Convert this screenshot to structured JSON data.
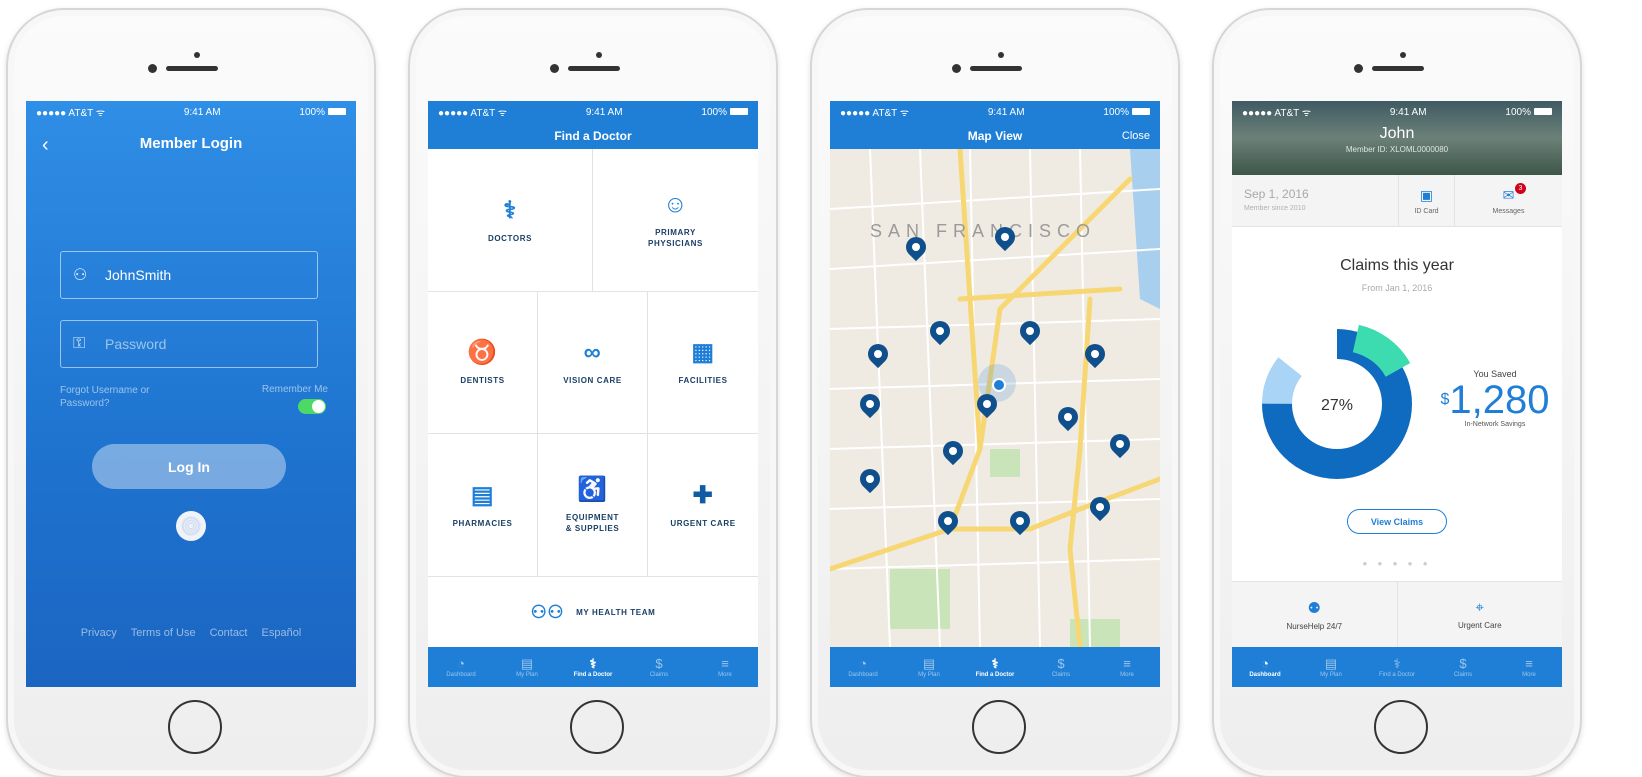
{
  "status": {
    "carrier": "●●●●● AT&T ᯤ",
    "time": "9:41 AM",
    "battery": "100%"
  },
  "login": {
    "title": "Member Login",
    "back": "‹",
    "username": "JohnSmith",
    "password_placeholder": "Password",
    "forgot": "Forgot Username or Password?",
    "remember": "Remember Me",
    "remember_on": true,
    "login_button": "Log In",
    "links": [
      "Privacy",
      "Terms of Use",
      "Contact",
      "Español"
    ]
  },
  "find_doctor": {
    "title": "Find a Doctor",
    "categories": [
      {
        "label1": "DOCTORS",
        "label2": "",
        "icon": "stethoscope-icon"
      },
      {
        "label1": "PRIMARY",
        "label2": "PHYSICIANS",
        "icon": "physician-icon"
      },
      {
        "label1": "DENTISTS",
        "label2": "",
        "icon": "tooth-icon"
      },
      {
        "label1": "VISION CARE",
        "label2": "",
        "icon": "glasses-icon"
      },
      {
        "label1": "FACILITIES",
        "label2": "",
        "icon": "building-icon"
      },
      {
        "label1": "PHARMACIES",
        "label2": "",
        "icon": "pill-bottle-icon"
      },
      {
        "label1": "EQUIPMENT",
        "label2": "& SUPPLIES",
        "icon": "wheelchair-icon"
      },
      {
        "label1": "URGENT CARE",
        "label2": "",
        "icon": "urgent-care-pin-icon"
      }
    ],
    "health_team": "MY HEALTH TEAM"
  },
  "map_view": {
    "title": "Map View",
    "close": "Close",
    "city_label": "SAN FRANCISCO"
  },
  "dashboard": {
    "name": "John",
    "member_id": "Member ID: XLOML0000080",
    "date": "Sep 1, 2016",
    "member_since": "Member since 2010",
    "id_card": "ID Card",
    "messages": "Messages",
    "messages_count": "3",
    "claims_title": "Claims this year",
    "claims_sub": "From Jan 1, 2016",
    "percent": "27%",
    "you_saved": "You Saved",
    "currency": "$",
    "amount": "1,280",
    "network_savings": "In-Network Savings",
    "view_claims": "View Claims",
    "dots": "● ● ● ● ●",
    "quick": [
      "NurseHelp 24/7",
      "Urgent Care"
    ]
  },
  "tabs": [
    "Dashboard",
    "My Plan",
    "Find a Doctor",
    "Claims",
    "More"
  ],
  "colors": {
    "primary": "#1f7fd6",
    "dark": "#0f4f8c",
    "donut_dark": "#0f6bbf",
    "donut_light": "#a9d4f5",
    "donut_green": "#3ddbb0"
  }
}
